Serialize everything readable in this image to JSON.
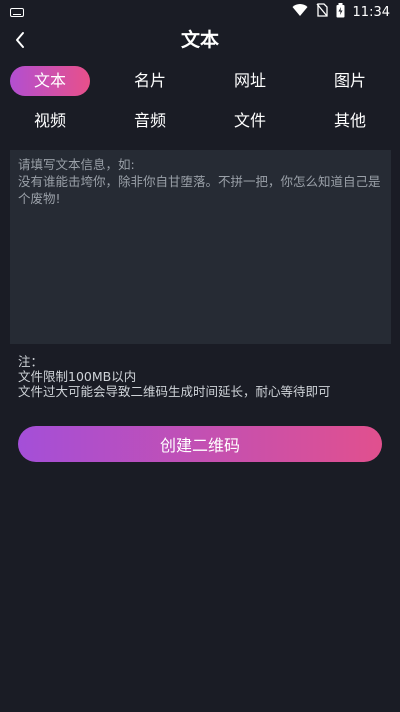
{
  "status_bar": {
    "time": "11:34",
    "left_icon": "keyboard-icon",
    "right_icons": [
      "wifi-icon",
      "no-sim-icon",
      "battery-charging-icon"
    ]
  },
  "header": {
    "title": "文本",
    "back_icon": "back-chevron-icon"
  },
  "tabs": {
    "row1": [
      "文本",
      "名片",
      "网址",
      "图片"
    ],
    "row2": [
      "视频",
      "音频",
      "文件",
      "其他"
    ],
    "active": "文本"
  },
  "input": {
    "placeholder": "请填写文本信息，如:\n没有谁能击垮你，除非你自甘堕落。不拼一把，你怎么知道自己是个废物!"
  },
  "notes": {
    "title": "注：",
    "line1": "文件限制100MB以内",
    "line2": "文件过大可能会导致二维码生成时间延长，耐心等待即可"
  },
  "actions": {
    "create_label": "创建二维码"
  },
  "colors": {
    "background": "#1a1c25",
    "input_bg": "#262b34",
    "gradient_start": "#a44fd8",
    "gradient_end": "#e1508e"
  }
}
